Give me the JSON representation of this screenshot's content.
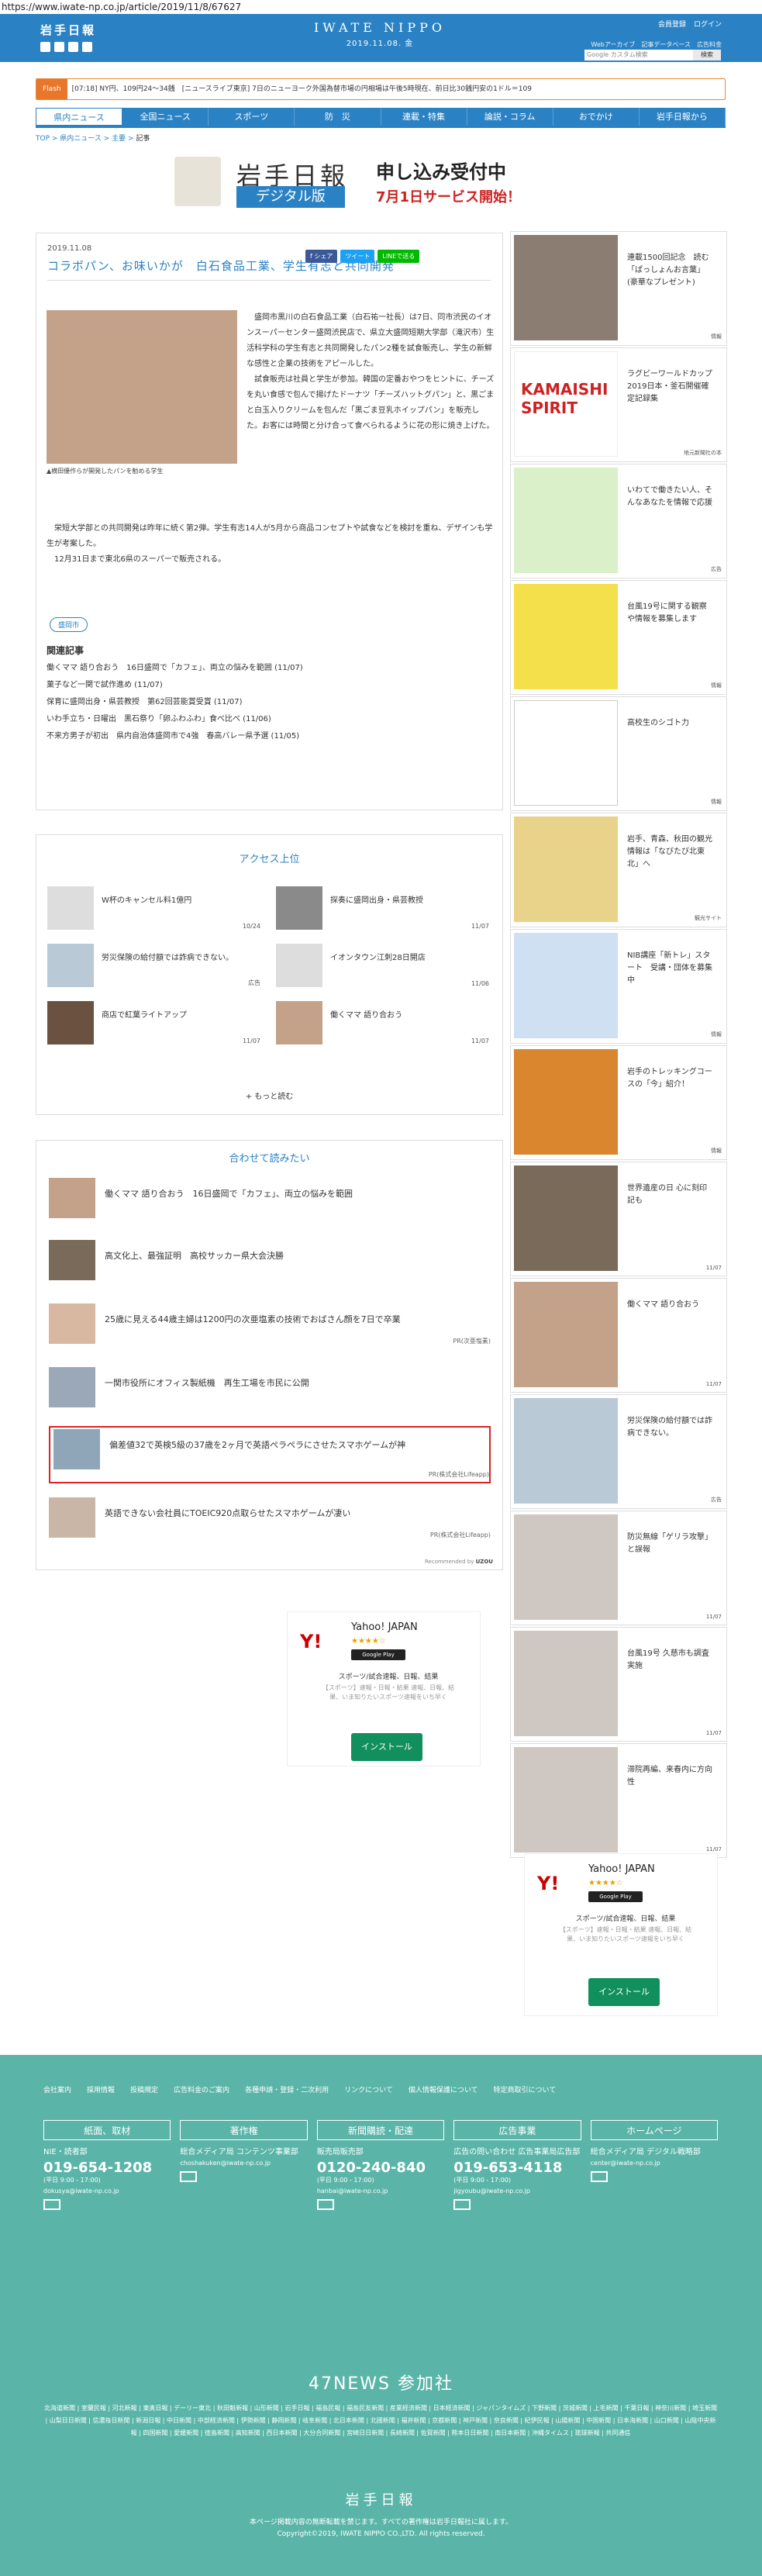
{
  "url": "https://www.iwate-np.co.jp/article/2019/11/8/67627",
  "header": {
    "logo": "岩手日報",
    "center_title": "IWATE NIPPO",
    "date": "2019.11.08. 金",
    "links_top": [
      "会員登録",
      "ログイン"
    ],
    "links_sub": [
      "Webアーカイブ",
      "記事データベース",
      "広告料金"
    ],
    "search_placeholder": "Google カスタム検索",
    "search_button": "検索"
  },
  "flash": {
    "label": "Flash",
    "text": "[07:18] NY円、109円24～34銭　[ニュースライブ東京] 7日のニューヨーク外国為替市場の円相場は午後5時現在、前日比30銭円安の1ドル＝109"
  },
  "nav": [
    "県内ニュース",
    "全国ニュース",
    "スポーツ",
    "防　災",
    "連載・特集",
    "論説・コラム",
    "おでかけ",
    "岩手日報から"
  ],
  "breadcrumb": {
    "a": "TOP",
    "b": "県内ニュース",
    "c": "主要",
    "d": "記事"
  },
  "banner": {
    "logo": "岩手日報",
    "product": "デジタル版",
    "headline": "申し込み受付中",
    "sub": "7月1日サービス開始！"
  },
  "article": {
    "date": "2019.11.08",
    "share": [
      "f シェア",
      "ツイート",
      "LINEで送る"
    ],
    "title": "コラボパン、お味いかが　白石食品工業、学生有志と共同開発",
    "caption": "▲横田優作らが開発したパンを勧める学生",
    "p1": "　盛岡市黒川の白石食品工業（白石祐一社長）は7日、同市渋民のイオンスーパーセンター盛岡渋民店で、県立大盛岡短期大学部（滝沢市）生活科学科の学生有志と共同開発したパン2種を試食販売し、学生の新鮮な感性と企業の技術をアピールした。",
    "p2": "　試食販売は社員と学生が参加。韓国の定番おやつをヒントに、チーズを丸い食感で包んで揚げたドーナツ「チーズハットグパン」と、黒ごまと白玉入りクリームを包んだ「黒ごま豆乳ホイップパン」を販売した。お客には時間と分け合って食べられるように花の形に焼き上げた。",
    "p3": "　栄短大学部との共同開発は昨年に続く第2弾。学生有志14人が5月から商品コンセプトや試食などを検討を重ね、デザインも学生が考案した。",
    "p4": "　12月31日まで東北6県のスーパーで販売される。",
    "tag": "盛岡市",
    "related_title": "関連記事",
    "related": [
      "働くママ 語り合おう　16日盛岡で「カフェ」、両立の悩みを範囲 (11/07)",
      "菓子など一関で試作進め (11/07)",
      "保育に盛岡出身・県芸教授　第62回芸能賞受賞 (11/07)",
      "いわ手立ち・日曜出　黒石祭り「卵ふわふわ」食べ比べ (11/06)",
      "不来方男子が初出　県内自治体盛岡市で4強　春高バレー県予選 (11/05)"
    ]
  },
  "access": {
    "title": "アクセス上位",
    "items": [
      {
        "t": "W杯のキャンセル料1億円",
        "d": "10/24"
      },
      {
        "t": "探奏に盛岡出身・県芸教授",
        "d": "11/07"
      },
      {
        "t": "労災保険の給付額では詐病できない。",
        "d": "広告"
      },
      {
        "t": "イオンタウン江刺28日開店",
        "d": "11/06"
      },
      {
        "t": "商店で紅葉ライトアップ",
        "d": "11/07"
      },
      {
        "t": "働くママ 語り合おう",
        "d": "11/07"
      }
    ],
    "more": "+ もっと読む"
  },
  "recommend": {
    "title": "合わせて読みたい",
    "items": [
      {
        "t": "働くママ 語り合おう　16日盛岡で「カフェ」、両立の悩みを範囲",
        "pr": ""
      },
      {
        "t": "高文化上、最強証明　高校サッカー県大会決勝",
        "pr": ""
      },
      {
        "t": "25歳に見える44歳主婦は1200円の次亜塩素の技術でおばさん顔を7日で卒業",
        "pr": "PR(次亜塩素)"
      },
      {
        "t": "一関市役所にオフィス製紙機　再生工場を市民に公開",
        "pr": ""
      },
      {
        "t": "偏差値32で英検5級の37歳を2ヶ月で英語ペラペラにさせたスマホゲームが神",
        "pr": "PR(株式会社Lifeapp)"
      },
      {
        "t": "英語できない会社員にTOEIC920点取らせたスマホゲームが凄い",
        "pr": "PR(株式会社Lifeapp)"
      }
    ],
    "powered": "Recommended by"
  },
  "ad": {
    "name": "Yahoo! JAPAN",
    "stars": "★★★★☆",
    "store": "Google Play",
    "desc": "スポーツ/試合速報、日報、結果",
    "desc2": "【スポーツ】速報・日報・結果 速報、日報、結果、いま知りたいスポーツ速報をいち早く",
    "install": "インストール"
  },
  "side": [
    {
      "t": "連載1500回記念　読む「ぱっしょんお言葉」(豪華なプレゼント)",
      "src": "情報"
    },
    {
      "t": "ラグビーワールドカップ2019日本・釜石開催確定記録集",
      "src": "地元新聞社の本"
    },
    {
      "t": "いわてで働きたい人、そんなあなたを情報で応援",
      "src": "広告"
    },
    {
      "t": "台風19号に関する観察や情報を募集します",
      "src": "情報"
    },
    {
      "t": "高校生のシゴト力",
      "src": "情報"
    },
    {
      "t": "岩手、青森、秋田の観光情報は「なびたび北東北」へ",
      "src": "観光サイト"
    },
    {
      "t": "NIB講座「新トレ」スタート　受講・団体を募集中",
      "src": "情報"
    },
    {
      "t": "岩手のトレッキングコースの「今」紹介！",
      "src": "情報"
    },
    {
      "t": "世界遺産の日 心に刻印記も",
      "src": "11/07"
    },
    {
      "t": "働くママ 語り合おう",
      "src": "11/07"
    },
    {
      "t": "労災保険の給付額では詐病できない。",
      "src": "広告"
    },
    {
      "t": "防災無線「ゲリラ攻撃」と誤報",
      "src": "11/07"
    },
    {
      "t": "台風19号 久慈市も調査実施",
      "src": "11/07"
    },
    {
      "t": "滞院再編、来春内に方向性",
      "src": "11/07"
    }
  ],
  "footer": {
    "links": [
      "会社案内",
      "採用情報",
      "投稿規定",
      "広告料金のご案内",
      "各種申請・登録・二次利用",
      "リンクについて",
      "個人情報保護について",
      "特定商取引について"
    ],
    "cols": [
      {
        "h": "紙面、取材",
        "sub": "NIE・読者部",
        "tel": "019-654-1208",
        "hr": "(平日 9:00 - 17:00)",
        "ml": "dokusya@iwate-np.co.jp"
      },
      {
        "h": "著作権",
        "sub": "総合メディア局 コンテンツ事業部",
        "tel": "",
        "hr": "",
        "ml": "choshakuken@iwate-np.co.jp"
      },
      {
        "h": "新聞購読・配達",
        "sub": "販売局販売部",
        "tel": "0120-240-840",
        "hr": "(平日 9:00 - 17:00)",
        "ml": "hanbai@iwate-np.co.jp"
      },
      {
        "h": "広告事業",
        "sub": "広告の問い合わせ 広告事業局広告部",
        "tel": "019-653-4118",
        "hr": "(平日 9:00 - 17:00)",
        "ml": "jigyoubu@iwate-np.co.jp"
      },
      {
        "h": "ホームページ",
        "sub": "総合メディア局 デジタル戦略部",
        "tel": "",
        "hr": "",
        "ml": "center@iwate-np.co.jp"
      }
    ],
    "n47": "47NEWS 参加社",
    "members": "北海道新聞 | 室蘭民報 | 河北新報 | 東奥日報 | デーリー東北 | 秋田魁新報 | 山形新聞 | 岩手日報 | 福島民報 | 福島民友新聞 | 産業経済新聞 | 日本経済新聞 | ジャパンタイムズ | 下野新聞 | 茨城新聞 | 上毛新聞 | 千葉日報 | 神奈川新聞 | 埼玉新聞 | 山梨日日新聞 | 信濃毎日新聞 | 新潟日報 | 中日新聞 | 中部経済新聞 | 伊勢新聞 | 静岡新聞 | 岐阜新聞 | 北日本新聞 | 北國新聞 | 福井新聞 | 京都新聞 | 神戸新聞 | 奈良新聞 | 紀伊民報 | 山陽新聞 | 中国新聞 | 日本海新聞 | 山口新聞 | 山陰中央新報 | 四国新聞 | 愛媛新聞 | 徳島新聞 | 高知新聞 | 西日本新聞 | 大分合同新聞 | 宮崎日日新聞 | 長崎新聞 | 佐賀新聞 | 熊本日日新聞 | 南日本新聞 | 沖縄タイムス | 琉球新報 | 共同通信",
    "logo": "岩手日報",
    "notice": "本ページ掲載内容の無断転載を禁じます。すべての著作権は岩手日報社に属します。",
    "copy": "Copyright©2019, IWATE NIPPO CO.,LTD. All rights reserved."
  },
  "colors": {
    "primary": "#2a82c4",
    "footer": "#5ab5a8",
    "flash": "#e8762b",
    "highlight": "#e02020"
  }
}
